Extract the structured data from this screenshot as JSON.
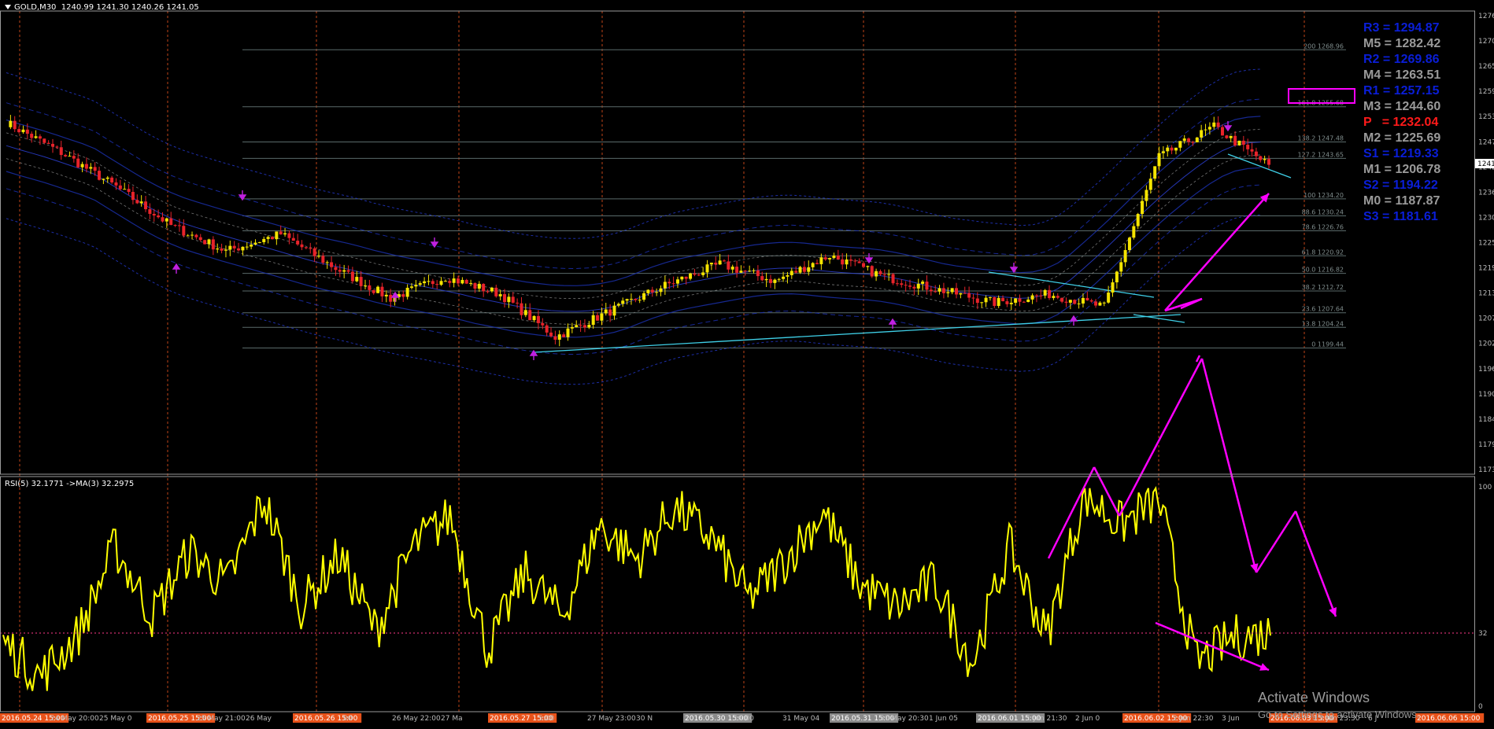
{
  "window": {
    "symbol": "GOLD,M30",
    "ohlc": "1240.99 1241.30 1240.26 1241.05"
  },
  "colors": {
    "background": "#000000",
    "candle_up": "#f5e400",
    "candle_down": "#e8232a",
    "bands_inner": "#1a2fa8",
    "bands_outer": "#2a3ed0",
    "trendline": "#3fd0e8",
    "annotation": "#ff00ff",
    "rsi": "#ffff00",
    "vline": "#ff5a1f",
    "fib": "#5a6a6a",
    "price_tag": "#ffffff"
  },
  "price_axis": {
    "ticks": [
      "1276",
      "1270",
      "1265",
      "1259",
      "1253",
      "1247",
      "1242",
      "1236",
      "1230",
      "1225",
      "1219",
      "1213",
      "1207",
      "1202",
      "1196",
      "1190",
      "1184",
      "1179",
      "1173"
    ],
    "current_price": "1241"
  },
  "fib_levels": [
    {
      "label": "200 1268.96",
      "price": 1268.96
    },
    {
      "label": "161.8 1255.68",
      "price": 1255.68
    },
    {
      "label": "138.2 1247.48",
      "price": 1247.48
    },
    {
      "label": "127.2 1243.65",
      "price": 1243.65
    },
    {
      "label": "100 1234.20",
      "price": 1234.2
    },
    {
      "label": "88.6 1230.24",
      "price": 1230.24
    },
    {
      "label": "78.6 1226.76",
      "price": 1226.76
    },
    {
      "label": "61.8 1220.92",
      "price": 1220.92
    },
    {
      "label": "50.0 1216.82",
      "price": 1216.82
    },
    {
      "label": "38.2 1212.72",
      "price": 1212.72
    },
    {
      "label": "23.6 1207.64",
      "price": 1207.64
    },
    {
      "label": "13.8 1204.24",
      "price": 1204.24
    },
    {
      "label": "0 1199.44",
      "price": 1199.44
    }
  ],
  "pivot_levels": [
    {
      "label": "R3 = 1294.87",
      "color": "#0a1ed8"
    },
    {
      "label": "M5 = 1282.42",
      "color": "#9a9a9a"
    },
    {
      "label": "R2 = 1269.86",
      "color": "#0a1ed8"
    },
    {
      "label": "M4 = 1263.51",
      "color": "#9a9a9a"
    },
    {
      "label": "R1 = 1257.15",
      "color": "#0a1ed8"
    },
    {
      "label": "M3 = 1244.60",
      "color": "#9a9a9a"
    },
    {
      "label": "P   = 1232.04",
      "color": "#ff1a1a"
    },
    {
      "label": "M2 = 1225.69",
      "color": "#9a9a9a"
    },
    {
      "label": "S1 = 1219.33",
      "color": "#0a1ed8"
    },
    {
      "label": "M1 = 1206.78",
      "color": "#9a9a9a"
    },
    {
      "label": "S2 = 1194.22",
      "color": "#0a1ed8"
    },
    {
      "label": "M0 = 1187.87",
      "color": "#9a9a9a"
    },
    {
      "label": "S3 = 1181.61",
      "color": "#0a1ed8"
    }
  ],
  "rsi": {
    "label": "RSI(5) 32.1771  ->MA(3) 32.2975",
    "axis": [
      "100",
      "32",
      "0"
    ],
    "level": 32
  },
  "time_axis": [
    {
      "label": "2016.05.24 15:00",
      "highlight": "orange"
    },
    {
      "label": "24 May 20:00"
    },
    {
      "label": "25 May 0"
    },
    {
      "label": "2016.05.25 15:00",
      "highlight": "orange"
    },
    {
      "label": "25 May 21:00"
    },
    {
      "label": "26 May"
    },
    {
      "label": "2016.05.26 15:00",
      "highlight": "orange"
    },
    {
      "label": "00"
    },
    {
      "label": "26 May 22:00"
    },
    {
      "label": "27 Ma"
    },
    {
      "label": "2016.05.27 15:00",
      "highlight": "orange"
    },
    {
      "label": "5:00"
    },
    {
      "label": "27 May 23:00"
    },
    {
      "label": "30 N"
    },
    {
      "label": "2016.05.30 15:00",
      "highlight": "gray"
    },
    {
      "label": "16:00"
    },
    {
      "label": "31 May 04"
    },
    {
      "label": "2016.05.31 15:00",
      "highlight": "gray"
    },
    {
      "label": "31 May 20:30"
    },
    {
      "label": "1 Jun 05"
    },
    {
      "label": "2016.06.01 15:00",
      "highlight": "gray"
    },
    {
      "label": "1 Jun 21:30"
    },
    {
      "label": "2 Jun 0"
    },
    {
      "label": "2016.06.02 15:00",
      "highlight": "orange"
    },
    {
      "label": "2 Jun 22:30"
    },
    {
      "label": "3 Jun"
    },
    {
      "label": "2016.06.03 15:00",
      "highlight": "orange"
    },
    {
      "label": "3 Jun 23:30"
    },
    {
      "label": "6 J"
    },
    {
      "label": "2016.06.06 15:00",
      "highlight": "orange"
    }
  ],
  "watermark": {
    "title": "Activate Windows",
    "subtitle": "Go to Settings to activate Windows."
  },
  "chart_data": {
    "type": "candlestick",
    "title": "GOLD,M30",
    "ylim": [
      1170,
      1278
    ],
    "x": [
      "24 May",
      "25 May",
      "26 May",
      "27 May",
      "30 May",
      "31 May",
      "1 Jun",
      "2 Jun",
      "3 Jun",
      "6 Jun"
    ],
    "series": [
      {
        "values": [
          1252,
          1245,
          1237,
          1228,
          1222,
          1226,
          1218,
          1211,
          1216,
          1212,
          1202,
          1208,
          1214,
          1219,
          1215,
          1221,
          1216,
          1213,
          1210,
          1212,
          1209,
          1244,
          1251,
          1242
        ]
      }
    ],
    "rsi": {
      "ylim": [
        0,
        100
      ],
      "values": [
        28,
        12,
        31,
        72,
        40,
        70,
        54,
        94,
        44,
        68,
        33,
        72,
        86,
        24,
        60,
        40,
        82,
        66,
        90,
        76,
        48,
        66,
        88,
        54,
        44,
        56,
        18,
        72,
        30,
        96,
        82,
        94,
        18,
        30,
        32
      ]
    }
  }
}
